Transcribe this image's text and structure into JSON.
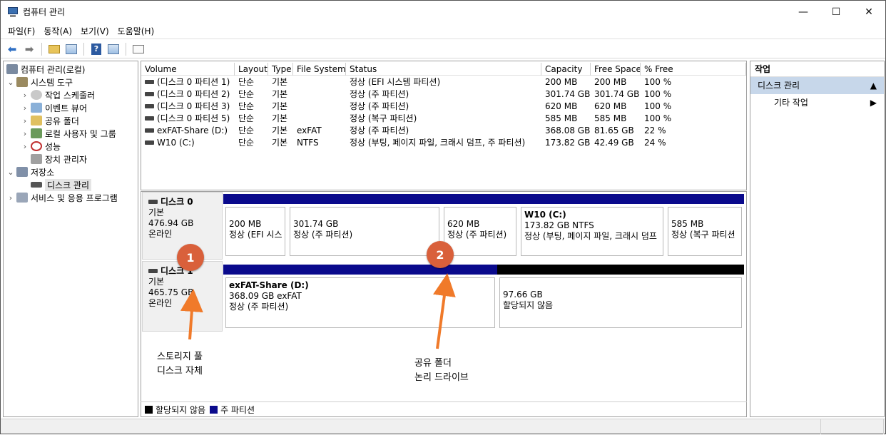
{
  "window": {
    "title": "컴퓨터 관리",
    "controls": [
      "—",
      "☐",
      "✕"
    ]
  },
  "menu": [
    "파일(F)",
    "동작(A)",
    "보기(V)",
    "도움말(H)"
  ],
  "tree": {
    "root": "컴퓨터 관리(로컬)",
    "system_tools": "시스템 도구",
    "task_scheduler": "작업 스케줄러",
    "event_viewer": "이벤트 뷰어",
    "shared_folders": "공유 폴더",
    "local_users": "로컬 사용자 및 그룹",
    "performance": "성능",
    "device_manager": "장치 관리자",
    "storage": "저장소",
    "disk_management": "디스크 관리",
    "services_apps": "서비스 및 응용 프로그램"
  },
  "volume_table": {
    "headers": [
      "Volume",
      "Layout",
      "Type",
      "File System",
      "Status",
      "Capacity",
      "Free Space",
      "% Free"
    ],
    "rows": [
      [
        "(디스크 0 파티션 1)",
        "단순",
        "기본",
        "",
        "정상 (EFI 시스템 파티션)",
        "200 MB",
        "200 MB",
        "100 %"
      ],
      [
        "(디스크 0 파티션 2)",
        "단순",
        "기본",
        "",
        "정상 (주 파티션)",
        "301.74 GB",
        "301.74 GB",
        "100 %"
      ],
      [
        "(디스크 0 파티션 3)",
        "단순",
        "기본",
        "",
        "정상 (주 파티션)",
        "620 MB",
        "620 MB",
        "100 %"
      ],
      [
        "(디스크 0 파티션 5)",
        "단순",
        "기본",
        "",
        "정상 (복구 파티션)",
        "585 MB",
        "585 MB",
        "100 %"
      ],
      [
        "exFAT-Share (D:)",
        "단순",
        "기본",
        "exFAT",
        "정상 (주 파티션)",
        "368.08 GB",
        "81.65 GB",
        "22 %"
      ],
      [
        "W10 (C:)",
        "단순",
        "기본",
        "NTFS",
        "정상 (부팅, 페이지 파일, 크래시 덤프, 주 파티션)",
        "173.82 GB",
        "42.49 GB",
        "24 %"
      ]
    ]
  },
  "disks": [
    {
      "name": "디스크 0",
      "type": "기본",
      "size": "476.94 GB",
      "status": "온라인",
      "partitions": [
        {
          "name": "",
          "line1": "200 MB",
          "line2": "정상 (EFI 시스",
          "bar": "#0a0a8c"
        },
        {
          "name": "",
          "line1": "301.74 GB",
          "line2": "정상 (주 파티션)",
          "bar": "#0a0a8c"
        },
        {
          "name": "",
          "line1": "620 MB",
          "line2": "정상 (주 파티션)",
          "bar": "#0a0a8c"
        },
        {
          "name": "W10  (C:)",
          "line1": "173.82 GB NTFS",
          "line2": "정상 (부팅, 페이지 파일, 크래시 덤프",
          "bar": "#0a0a8c"
        },
        {
          "name": "",
          "line1": "585 MB",
          "line2": "정상 (복구 파티션",
          "bar": "#0a0a8c"
        }
      ]
    },
    {
      "name": "디스크 1",
      "type": "기본",
      "size": "465.75 GB",
      "status": "온라인",
      "partitions": [
        {
          "name": "exFAT-Share  (D:)",
          "line1": "368.09 GB exFAT",
          "line2": "정상 (주 파티션)",
          "bar": "#0a0a8c"
        },
        {
          "name": "",
          "line1": "97.66 GB",
          "line2": "할당되지 않음",
          "bar": "#000000"
        }
      ]
    }
  ],
  "legend": [
    {
      "label": "할당되지 않음",
      "color": "#000000"
    },
    {
      "label": "주 파티션",
      "color": "#0a0a8c"
    }
  ],
  "actions": {
    "header": "작업",
    "selected": "디스크 관리",
    "more": "기타 작업"
  },
  "annotations": {
    "callout1": "1",
    "callout2": "2",
    "note1_line1": "스토리지 풀",
    "note1_line2": "디스크 자체",
    "note2_line1": "공유 폴더",
    "note2_line2": "논리 드라이브",
    "color": "#d9603b",
    "arrow_color": "#f07a2a"
  }
}
